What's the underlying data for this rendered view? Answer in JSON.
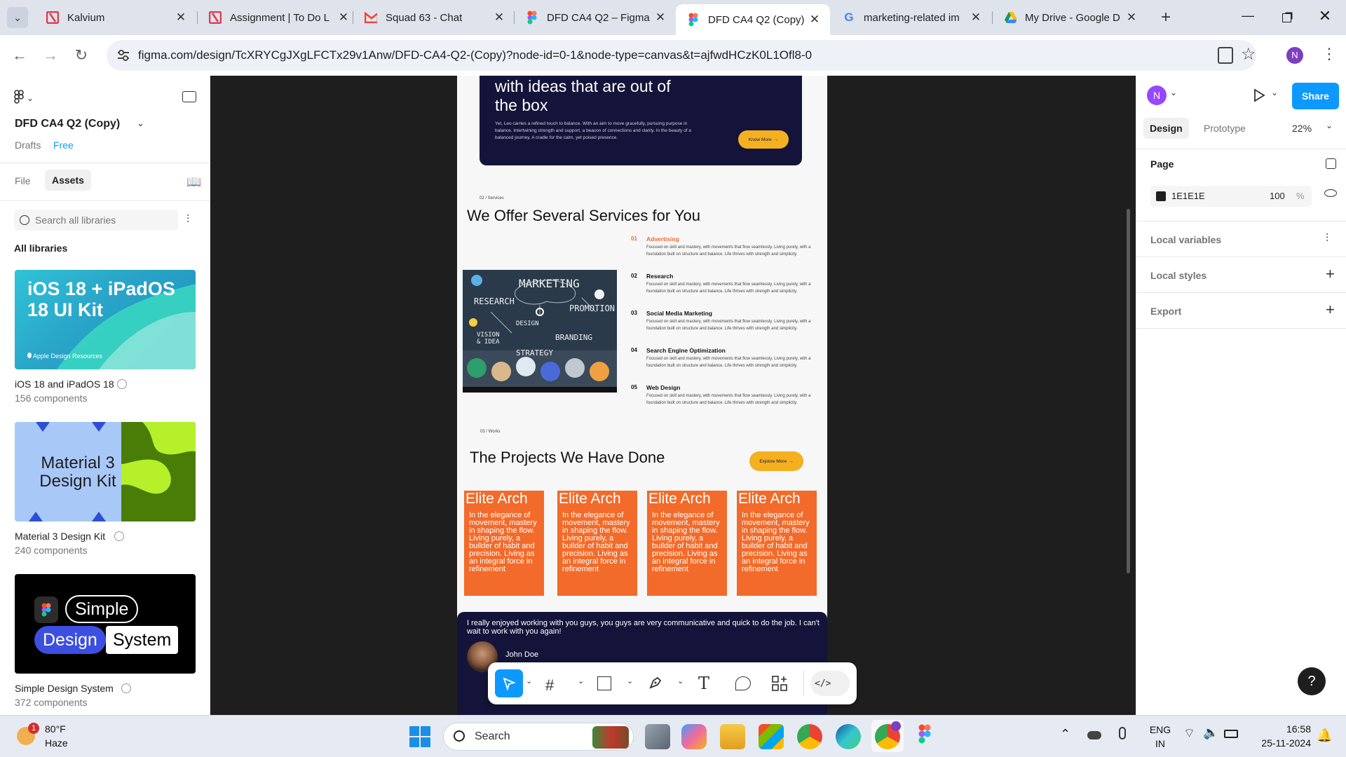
{
  "browser": {
    "tabs": [
      {
        "title": "Kalvium",
        "icon": "kalvium-icon"
      },
      {
        "title": "Assignment | To Do L",
        "icon": "kalvium-icon"
      },
      {
        "title": "Squad 63 - Chat",
        "icon": "gmail-icon"
      },
      {
        "title": "DFD CA4 Q2 – Figma",
        "icon": "figma-icon"
      },
      {
        "title": "DFD CA4 Q2 (Copy) -",
        "icon": "figma-icon"
      },
      {
        "title": "marketing-related im",
        "icon": "google-icon"
      },
      {
        "title": "My Drive - Google D",
        "icon": "drive-icon"
      }
    ],
    "url": "figma.com/design/TcXRYCgJXgLFCTx29v1Anw/DFD-CA4-Q2-(Copy)?node-id=0-1&node-type=canvas&t=ajfwdHCzK0L1Ofl8-0",
    "profile_initial": "N"
  },
  "left_panel": {
    "file_name": "DFD CA4 Q2 (Copy)",
    "location": "Drafts",
    "plan_badge": "Free",
    "tabs": [
      "File",
      "Assets"
    ],
    "active_tab": "Assets",
    "search_placeholder": "Search all libraries",
    "section_title": "All libraries",
    "libraries": [
      {
        "name": "iOS 18 and iPadOS 18",
        "count": "156 components",
        "thumb_title": "iOS 18 + iPadOS 18 UI Kit",
        "thumb_sub": "Apple Design Resources"
      },
      {
        "name": "Material 3 Design Kit",
        "count": "240 components",
        "thumb_title": "Material 3 Design Kit"
      },
      {
        "name": "Simple Design System",
        "count": "372 components",
        "thumb_words": [
          "Simple",
          "Design",
          "System"
        ]
      }
    ]
  },
  "right_panel": {
    "avatar_initial": "N",
    "share_label": "Share",
    "tabs": [
      "Design",
      "Prototype"
    ],
    "active_tab": "Design",
    "zoom": "22%",
    "page_title": "Page",
    "page_color": "1E1E1E",
    "page_opacity": "100",
    "opacity_unit": "%",
    "sections": [
      "Local variables",
      "Local styles",
      "Export"
    ]
  },
  "design_frame": {
    "hero": {
      "heading_line1": "with ideas that are out of",
      "heading_line2": "the box",
      "body": "Yet, Leo carries a refined touch to balance. With an aim to move gracefully, pursuing purpose in balance. Intertwining strength and support, a beacon of connections and clarity. In the beauty of a balanced journey. A cradle for the calm, yet poised presence.",
      "button": "Know More"
    },
    "services": {
      "eyebrow": "02 / Services",
      "title": "We Offer Several Services for You",
      "image_words": [
        "MARKETING",
        "RESEARCH",
        "PROMOTION",
        "DESIGN",
        "VISION & IDEA",
        "BRANDING",
        "STRATEGY"
      ],
      "items": [
        {
          "num": "01",
          "title": "Advertising",
          "desc": "Focused on skill and mastery, with movements that flow seamlessly. Living purely, with a foundation built on structure and balance. Life thrives with strength and simplicity."
        },
        {
          "num": "02",
          "title": "Research",
          "desc": "Focused on skill and mastery, with movements that flow seamlessly. Living purely, with a foundation built on structure and balance. Life thrives with strength and simplicity."
        },
        {
          "num": "03",
          "title": "Social Media Marketing",
          "desc": "Focused on skill and mastery, with movements that flow seamlessly. Living purely, with a foundation built on structure and balance. Life thrives with strength and simplicity."
        },
        {
          "num": "04",
          "title": "Search Engine Optimization",
          "desc": "Focused on skill and mastery, with movements that flow seamlessly. Living purely, with a foundation built on structure and balance. Life thrives with strength and simplicity."
        },
        {
          "num": "05",
          "title": "Web Design",
          "desc": "Focused on skill and mastery, with movements that flow seamlessly. Living purely, with a foundation built on structure and balance. Life thrives with strength and simplicity."
        }
      ]
    },
    "projects": {
      "eyebrow": "03 / Works",
      "title": "The Projects We Have Done",
      "button": "Explore More",
      "cards": [
        {
          "title": "Elite Arch",
          "desc": "In the elegance of movement, mastery in shaping the flow. Living purely, a builder of habit and precision. Living as an integral force in refinement"
        },
        {
          "title": "Elite Arch",
          "desc": "In the elegance of movement, mastery in shaping the flow. Living purely, a builder of habit and precision. Living as an integral force in refinement"
        },
        {
          "title": "Elite Arch",
          "desc": "In the elegance of movement, mastery in shaping the flow. Living purely, a builder of habit and precision. Living as an integral force in refinement"
        },
        {
          "title": "Elite Arch",
          "desc": "In the elegance of movement, mastery in shaping the flow. Living purely, a builder of habit and precision. Living as an integral force in refinement"
        }
      ]
    },
    "testimonial": {
      "quote": "I really enjoyed working with you guys, you guys are very communicative and quick to do the job. I can't wait to work with you again!",
      "author": "John Doe"
    }
  },
  "toolbar": {
    "tools": [
      "move-tool",
      "frame-tool",
      "shape-tool",
      "pen-tool",
      "text-tool",
      "comment-tool",
      "actions-tool",
      "dev-mode-toggle"
    ]
  },
  "help_label": "?",
  "taskbar": {
    "weather_temp": "80°F",
    "weather_desc": "Haze",
    "weather_badge": "1",
    "search_label": "Search",
    "lang_line1": "ENG",
    "lang_line2": "IN",
    "time": "16:58",
    "date": "25-11-2024"
  },
  "colors": {
    "figma_blue": "#0d99ff",
    "accent_orange": "#f26b2a",
    "accent_yellow": "#f5b020",
    "navy": "#14143a",
    "canvas_bg": "#1e1e1e"
  }
}
